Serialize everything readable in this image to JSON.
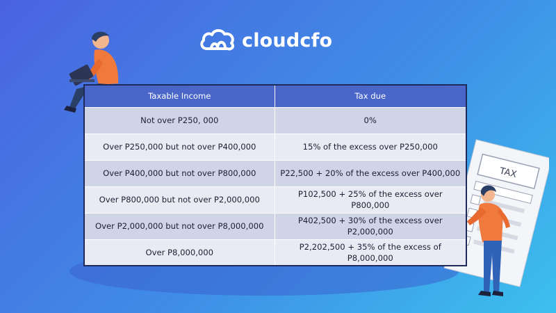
{
  "brand": {
    "name": "cloudcfo",
    "icon": "cloud-logo-icon"
  },
  "table": {
    "headers": [
      "Taxable Income",
      "Tax due"
    ],
    "rows": [
      [
        "Not over P250, 000",
        "0%"
      ],
      [
        "Over P250,000 but not over P400,000",
        "15% of the excess over P250,000"
      ],
      [
        "Over P400,000 but not over P800,000",
        "P22,500 + 20% of the excess over P400,000"
      ],
      [
        "Over P800,000 but not over P2,000,000",
        "P102,500 + 25% of the excess over P800,000"
      ],
      [
        "Over P2,000,000 but not over P8,000,000",
        "P402,500 + 30% of the excess over P2,000,000"
      ],
      [
        "Over P8,000,000",
        "P2,202,500 + 35% of the excess of P8,000,000"
      ]
    ]
  },
  "tax_form": {
    "label": "TAX"
  },
  "colors": {
    "header": "#4a66c8",
    "row_dark": "#cfd4e7",
    "row_light": "#e8ebf4",
    "background_start": "#4a63e0",
    "background_end": "#3cc0ee"
  }
}
